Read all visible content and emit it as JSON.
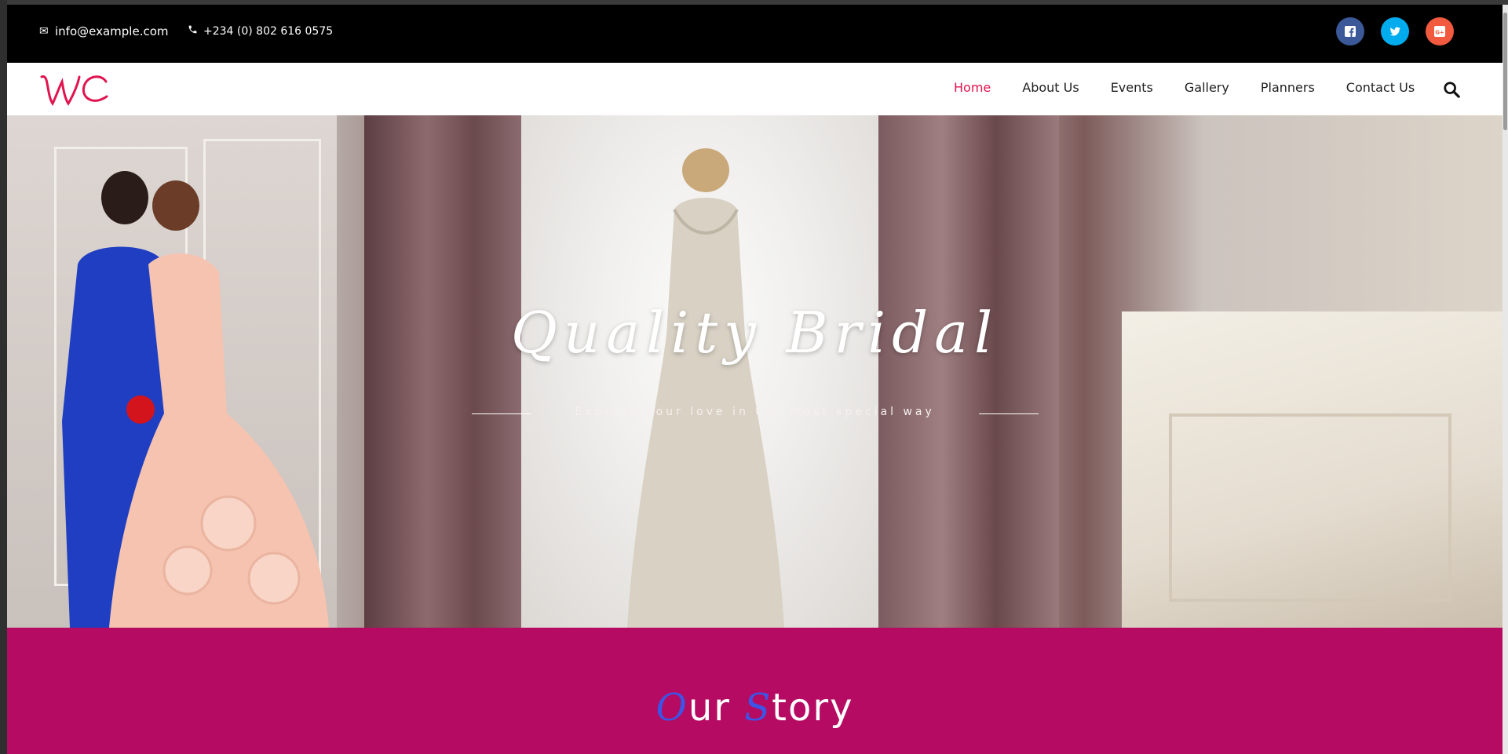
{
  "topbar": {
    "email": "info@example.com",
    "phone": "+234 (0) 802 616 0575",
    "socials": [
      "facebook-icon",
      "twitter-icon",
      "google-plus-icon"
    ],
    "social_colors": {
      "facebook": "#3b5998",
      "twitter": "#00aced",
      "google_plus": "#f15a3f"
    }
  },
  "nav": {
    "logo_text": "WC",
    "items": [
      {
        "label": "Home",
        "active": true
      },
      {
        "label": "About Us",
        "active": false
      },
      {
        "label": "Events",
        "active": false
      },
      {
        "label": "Gallery",
        "active": false
      },
      {
        "label": "Planners",
        "active": false
      },
      {
        "label": "Contact Us",
        "active": false
      }
    ],
    "active_color": "#e0144f"
  },
  "hero": {
    "title": "Quality Bridal",
    "subtitle": "Express your love in the most special way"
  },
  "story": {
    "title_first_cap": "O",
    "title_first_rest": "ur",
    "title_second_cap": "S",
    "title_second_rest": "tory",
    "background": "#b50b62",
    "accent": "#3c55e6"
  }
}
